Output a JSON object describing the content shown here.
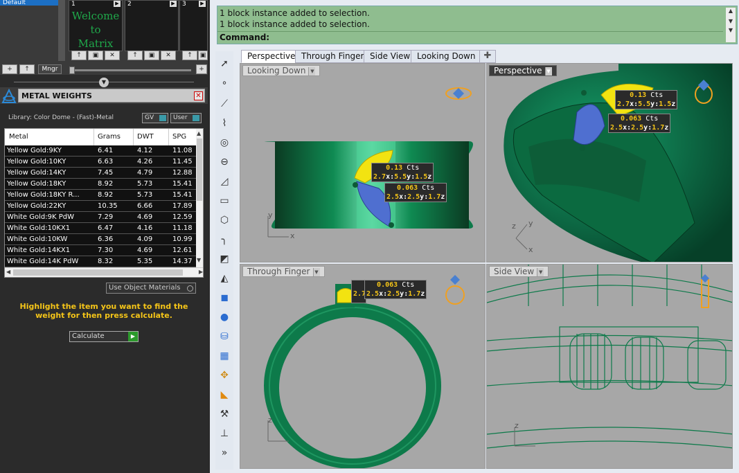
{
  "layers": {
    "item_label": "Default",
    "thumbs": [
      {
        "num": "1",
        "text_line1": "Welcome to",
        "text_line2": "Matrix"
      },
      {
        "num": "2"
      },
      {
        "num": "3"
      }
    ],
    "mngr_label": "Mngr"
  },
  "metal_weights": {
    "title": "METAL WEIGHTS",
    "library": "Library: Color Dome - (Fast)-Metal",
    "gv_label": "GV",
    "user_label": "User",
    "columns": [
      "Metal",
      "Grams",
      "DWT",
      "SPG"
    ],
    "rows": [
      [
        "Yellow Gold:9KY",
        "6.41",
        "4.12",
        "11.08"
      ],
      [
        "Yellow Gold:10KY",
        "6.63",
        "4.26",
        "11.45"
      ],
      [
        "Yellow Gold:14KY",
        "7.45",
        "4.79",
        "12.88"
      ],
      [
        "Yellow Gold:18KY",
        "8.92",
        "5.73",
        "15.41"
      ],
      [
        "Yellow Gold:18KY R...",
        "8.92",
        "5.73",
        "15.41"
      ],
      [
        "Yellow Gold:22KY",
        "10.35",
        "6.66",
        "17.89"
      ],
      [
        "White Gold:9K PdW",
        "7.29",
        "4.69",
        "12.59"
      ],
      [
        "White Gold:10KX1",
        "6.47",
        "4.16",
        "11.18"
      ],
      [
        "White Gold:10KW",
        "6.36",
        "4.09",
        "10.99"
      ],
      [
        "White Gold:14KX1",
        "7.30",
        "4.69",
        "12.61"
      ],
      [
        "White Gold:14K PdW",
        "8.32",
        "5.35",
        "14.37"
      ]
    ],
    "use_object_materials": "Use Object Materials",
    "hint": "Highlight the item you want to find the weight for then press calculate.",
    "calculate_label": "Calculate"
  },
  "command": {
    "history": [
      "1 block instance added to selection.",
      "1 block instance added to selection."
    ],
    "prompt": "Command:"
  },
  "tabs": [
    "Perspective",
    "Through Finger",
    "Side View",
    "Looking Down"
  ],
  "viewports": {
    "looking_down": {
      "label": "Looking Down",
      "axis_y": "y",
      "axis_x": "x"
    },
    "perspective": {
      "label": "Perspective",
      "axis_z": "z",
      "axis_y": "y",
      "axis_x": "x"
    },
    "through_finger": {
      "label": "Through Finger",
      "axis_z": "z"
    },
    "side_view": {
      "label": "Side View",
      "axis_z": "z"
    }
  },
  "gem_labels": {
    "big": {
      "cts": "0.13",
      "unit": "Cts",
      "x": "2.7",
      "y": "5.5",
      "z": "1.5"
    },
    "small": {
      "cts": "0.063",
      "unit": "Cts",
      "x": "2.5",
      "y": "2.5",
      "z": "1.7"
    },
    "partial_x": "2.7"
  },
  "colors": {
    "ring_green": "#0d7a4a",
    "gem_yellow": "#f2e311",
    "gem_blue": "#4f6fd0",
    "viewport_bg": "#a7a7a7",
    "command_bg": "#8fbd8f",
    "hint_yellow": "#f5c518"
  }
}
